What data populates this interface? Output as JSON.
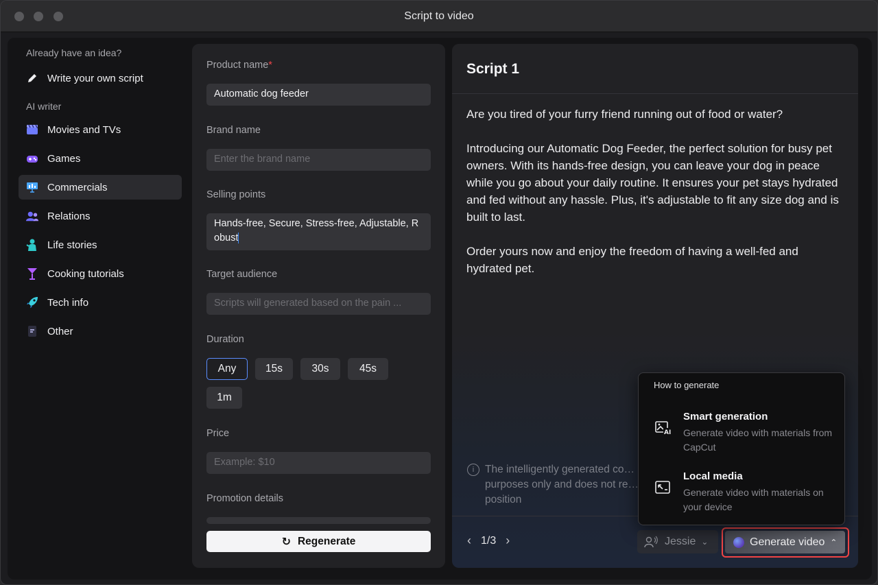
{
  "window": {
    "title": "Script to video"
  },
  "sidebar": {
    "heading_idea": "Already have an idea?",
    "write_own": "Write your own script",
    "heading_ai": "AI writer",
    "items": [
      {
        "label": "Movies and TVs",
        "icon": "clapperboard-icon",
        "color": "#6e7bff"
      },
      {
        "label": "Games",
        "icon": "gamepad-icon",
        "color": "#8a5cff"
      },
      {
        "label": "Commercials",
        "icon": "presentation-chart-icon",
        "color": "#4aa8ff"
      },
      {
        "label": "Relations",
        "icon": "people-icon",
        "color": "#6e6bff"
      },
      {
        "label": "Life stories",
        "icon": "person-icon",
        "color": "#2ec9c9"
      },
      {
        "label": "Cooking tutorials",
        "icon": "cocktail-glass-icon",
        "color": "#b05cff"
      },
      {
        "label": "Tech info",
        "icon": "rocket-icon",
        "color": "#3ad0e0"
      },
      {
        "label": "Other",
        "icon": "document-icon",
        "color": "#3a3a50"
      }
    ],
    "active": "Commercials"
  },
  "form": {
    "product_label": "Product name",
    "product_required": "*",
    "product_value": "Automatic dog feeder",
    "brand_label": "Brand name",
    "brand_placeholder": "Enter the brand name",
    "selling_label": "Selling points",
    "selling_value": "Hands-free, Secure, Stress-free, Adjustable, Robust",
    "audience_label": "Target audience",
    "audience_placeholder": "Scripts will generated based on the pain ...",
    "duration_label": "Duration",
    "durations": [
      "Any",
      "15s",
      "30s",
      "45s",
      "1m"
    ],
    "duration_selected": "Any",
    "price_label": "Price",
    "price_placeholder": "Example: $10",
    "promo_label": "Promotion details",
    "regenerate": "Regenerate"
  },
  "script": {
    "title": "Script 1",
    "paragraphs": [
      "Are you tired of your furry friend running out of food or water?",
      "Introducing our Automatic Dog Feeder, the perfect solution for busy pet owners. With its hands-free design, you can leave your dog in peace while you go about your daily routine. It ensures your pet stays hydrated and fed without any hassle. Plus, it's adjustable to fit any size dog and is built to last.",
      "Order yours now and enjoy the freedom of having a well-fed and hydrated pet."
    ],
    "disclaimer": "The intelligently generated co… purposes only and does not re… position",
    "pager": "1/3",
    "voice": "Jessie",
    "generate": "Generate video"
  },
  "popup": {
    "heading": "How to generate",
    "options": [
      {
        "title": "Smart generation",
        "desc": "Generate video with materials from CapCut",
        "icon": "ai-image-icon"
      },
      {
        "title": "Local media",
        "desc": "Generate video with materials on your device",
        "icon": "local-media-icon"
      }
    ]
  }
}
